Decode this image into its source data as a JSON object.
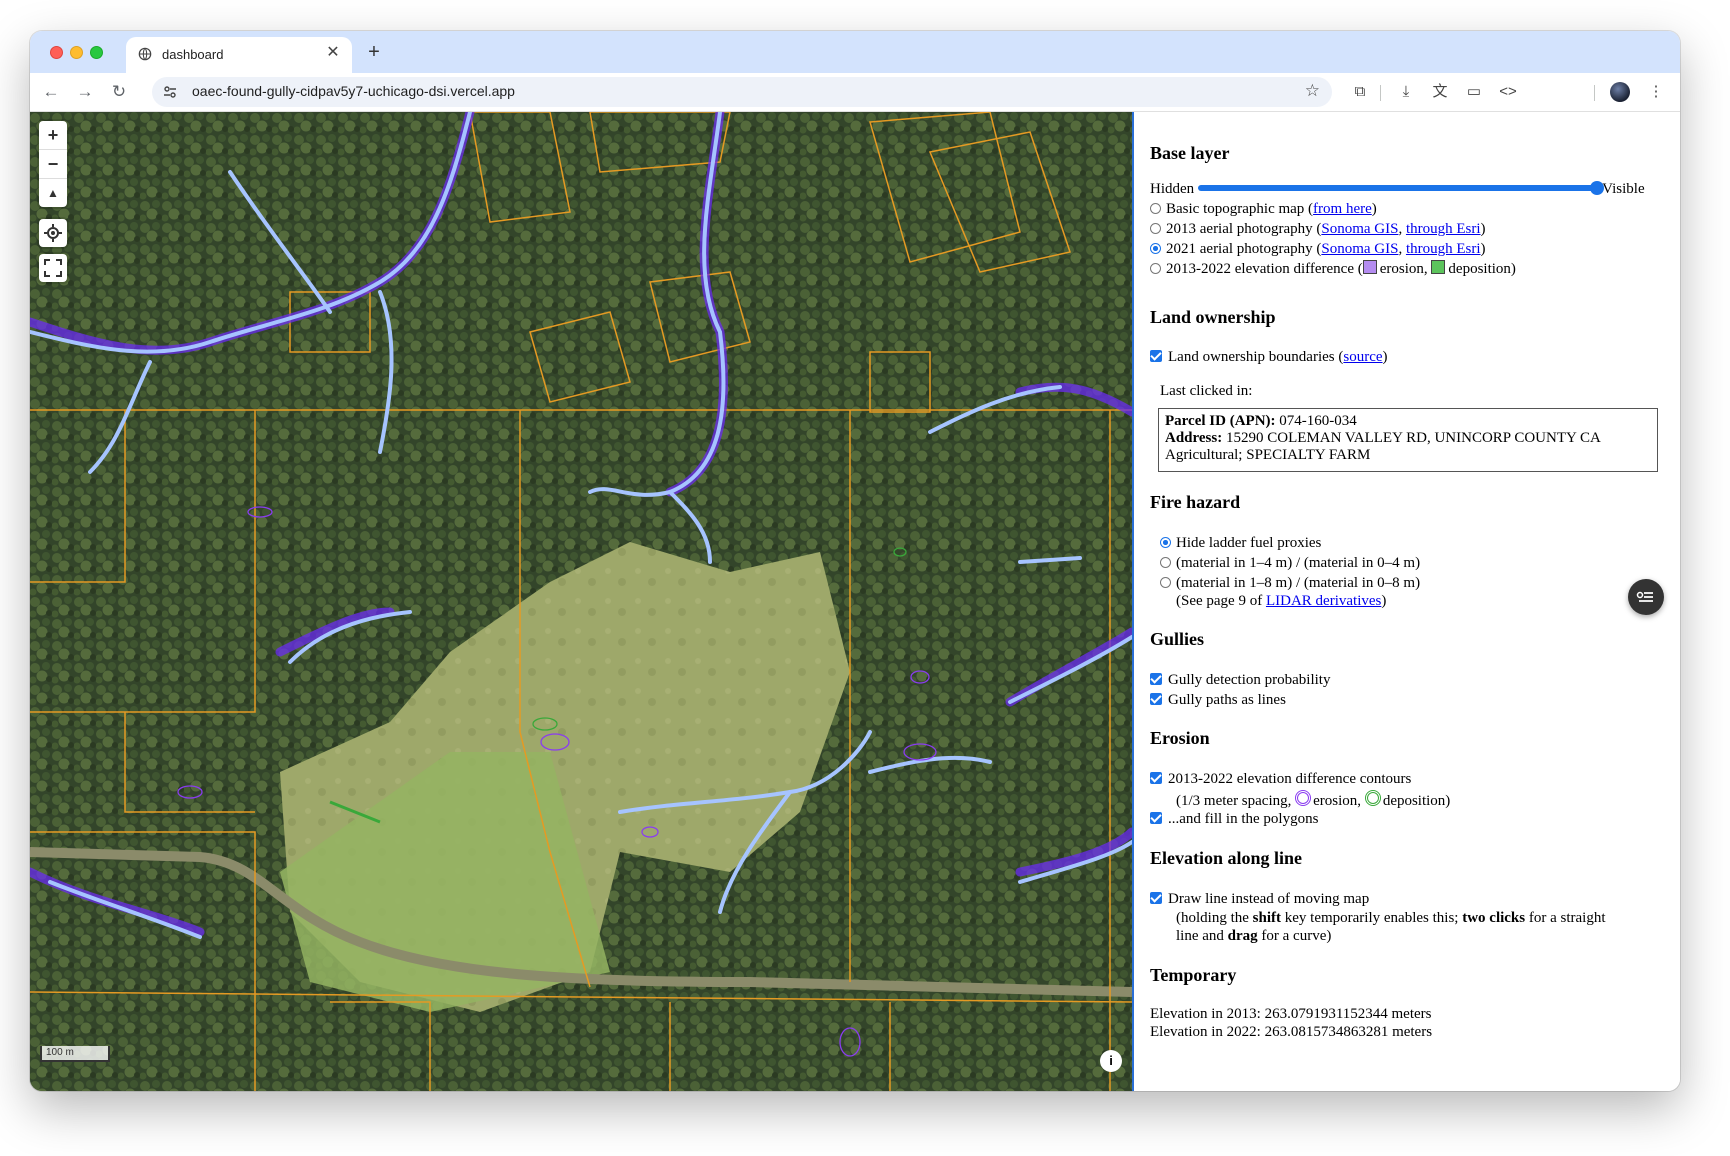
{
  "browser": {
    "tab_title": "dashboard",
    "url": "oaec-found-gully-cidpav5y7-uchicago-dsi.vercel.app",
    "accent": "#d3e3fd"
  },
  "map": {
    "scale_label": "100 m",
    "attribution_icon": "info-icon",
    "zoom_in_label": "+",
    "zoom_out_label": "−",
    "compass_label": "▲"
  },
  "panel": {
    "base_layer": {
      "heading": "Base layer",
      "slider_left": "Hidden",
      "slider_right": "Visible",
      "slider_value": 1.0,
      "options": [
        {
          "label": "Basic topographic map (",
          "link1": "from here",
          "tail": ")",
          "selected": false
        },
        {
          "label": "2013 aerial photography (",
          "link1": "Sonoma GIS",
          "sep": ", ",
          "link2": "through Esri",
          "tail": ")",
          "selected": false
        },
        {
          "label": "2021 aerial photography (",
          "link1": "Sonoma GIS",
          "sep": ", ",
          "link2": "through Esri",
          "tail": ")",
          "selected": true
        },
        {
          "label": "2013-2022 elevation difference (",
          "erosion": "erosion,",
          "deposition": "deposition)",
          "selected": false
        }
      ],
      "erosion_color": "#b48cf0",
      "deposition_color": "#5cc45c"
    },
    "land": {
      "heading": "Land ownership",
      "checkbox_label": "Land ownership boundaries (",
      "checkbox_link": "source",
      "checkbox_tail": ")",
      "last_clicked": "Last clicked in:",
      "parcel_label": "Parcel ID (APN):",
      "parcel_value": "074-160-034",
      "address_label": "Address:",
      "address_value": "15290 COLEMAN VALLEY RD, UNINCORP COUNTY CA",
      "use": "Agricultural; SPECIALTY FARM"
    },
    "fire": {
      "heading": "Fire hazard",
      "options": [
        {
          "label": "Hide ladder fuel proxies",
          "selected": true
        },
        {
          "label": "(material in 1–4 m) / (material in 0–4 m)",
          "selected": false
        },
        {
          "label": "(material in 1–8 m) / (material in 0–8 m)",
          "selected": false
        }
      ],
      "note_prefix": "(See page 9 of ",
      "note_link": "LIDAR derivatives",
      "note_suffix": ")"
    },
    "gullies": {
      "heading": "Gullies",
      "items": [
        "Gully detection probability",
        "Gully paths as lines"
      ]
    },
    "erosion": {
      "heading": "Erosion",
      "item1": "2013-2022 elevation difference contours",
      "sub_prefix": "(1/3 meter spacing,",
      "sub_erosion": "erosion,",
      "sub_deposition": "deposition)",
      "item2": "...and fill in the polygons"
    },
    "elevation_line": {
      "heading": "Elevation along line",
      "item": "Draw line instead of moving map",
      "help_1a": "(holding the ",
      "help_1b": "shift",
      "help_1c": " key temporarily enables this; ",
      "help_1d": "two clicks",
      "help_1e": " for a straight",
      "help_2a": "line and ",
      "help_2b": "drag",
      "help_2c": " for a curve)"
    },
    "temporary": {
      "heading": "Temporary",
      "line1": "Elevation in 2013: 263.0791931152344 meters",
      "line2": "Elevation in 2022: 263.0815734863281 meters"
    }
  }
}
